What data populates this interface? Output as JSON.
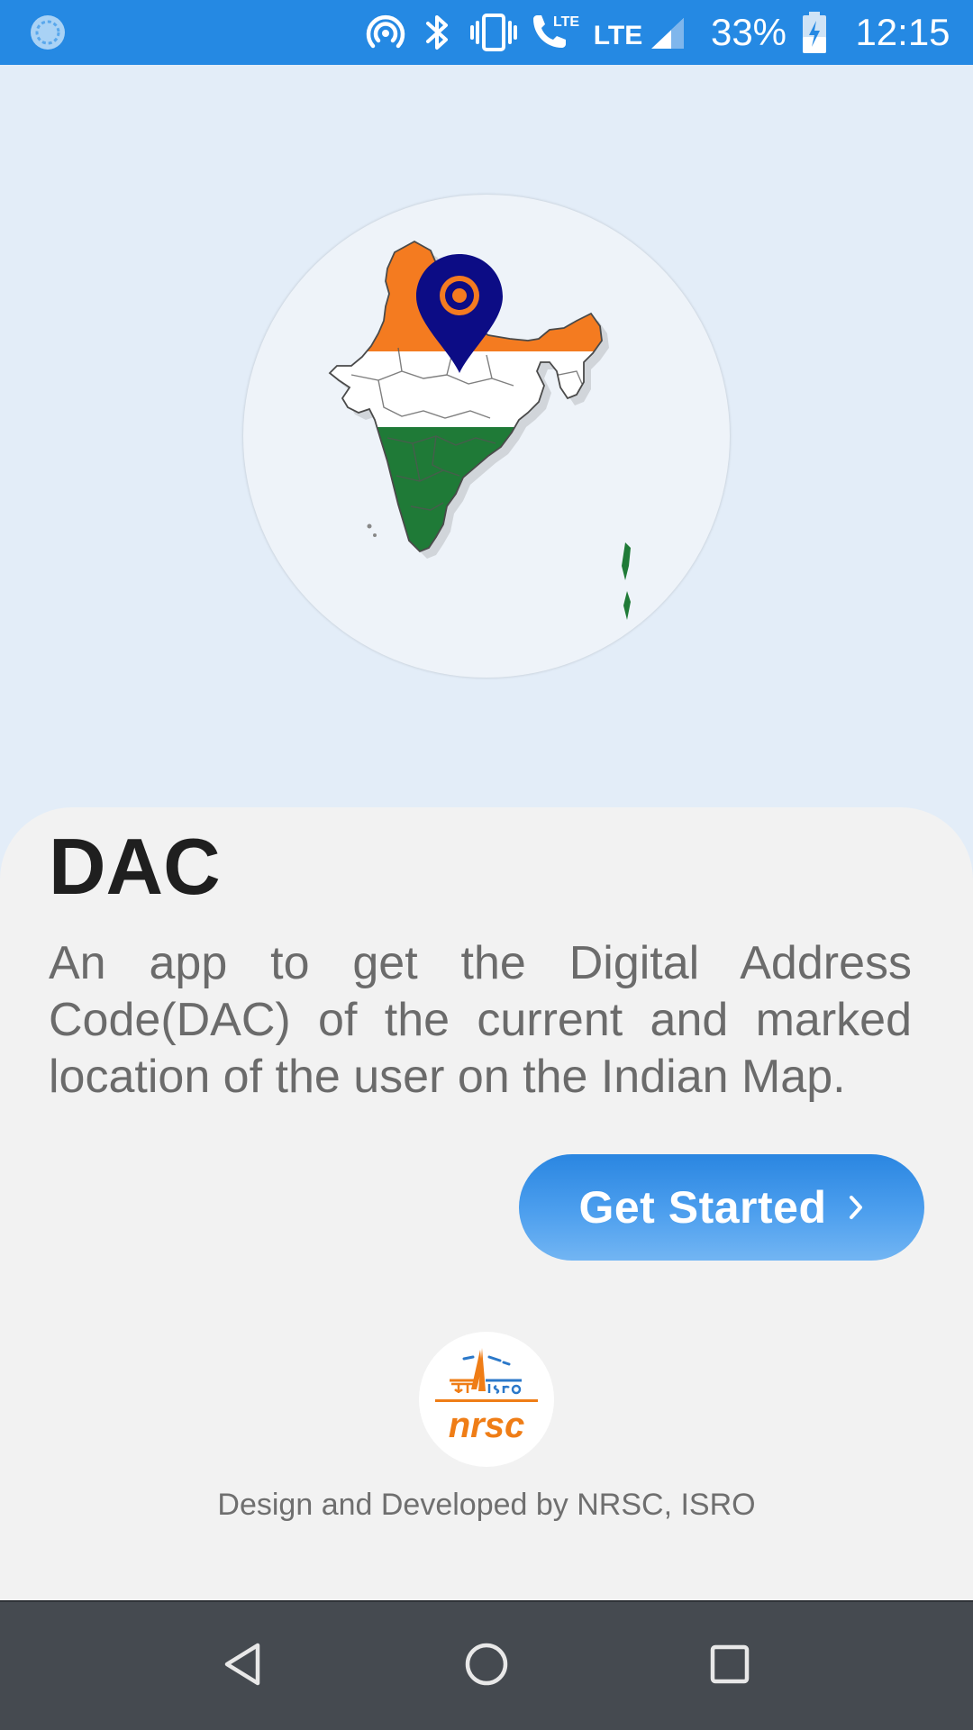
{
  "status_bar": {
    "battery_percent": "33%",
    "time": "12:15",
    "network_1": "LTE",
    "network_2": "LTE",
    "icons": [
      "sync-icon",
      "hotspot-icon",
      "bluetooth-icon",
      "vibrate-icon",
      "volte-call-icon",
      "signal-icon",
      "battery-charging-icon"
    ]
  },
  "hero": {
    "image": "india-map-with-location-pin",
    "colors": {
      "saffron": "#f47b20",
      "white": "#ffffff",
      "green": "#1f7a37",
      "pin": "#0c0c85"
    }
  },
  "main": {
    "title": "DAC",
    "description": "An app to get the Digital Address Code(DAC) of the current and marked location of the user on the Indian Map.",
    "cta_label": "Get Started",
    "cta_icon": "chevron-right-icon"
  },
  "footer": {
    "logo_text": "nrsc",
    "credit": "Design and Developed by NRSC, ISRO"
  },
  "nav_bar": {
    "buttons": [
      "back-icon",
      "home-icon",
      "recents-icon"
    ]
  },
  "colors": {
    "status_bar": "#2589e3",
    "background": "#e3edf8",
    "sheet": "#f2f2f2",
    "button": "#3b93e8",
    "nav_bar": "#454a50"
  }
}
